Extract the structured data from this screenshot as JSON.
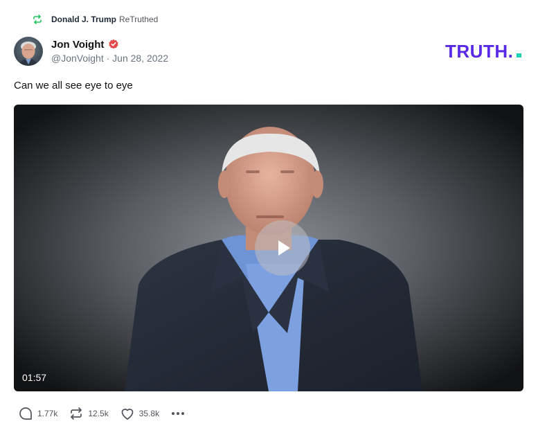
{
  "retruth": {
    "icon": "retruth-icon",
    "user": "Donald J. Trump",
    "label": "ReTruthed",
    "accent": "#22c55e"
  },
  "author": {
    "display_name": "Jon Voight",
    "handle": "@JonVoight",
    "separator": "·",
    "date": "Jun 28, 2022",
    "verified_color": "#e5484d",
    "avatar": "avatar-photo"
  },
  "brand": {
    "logo_text": "TRUTH.",
    "primary": "#5a29e8",
    "accent": "#1dd3b0"
  },
  "post": {
    "text": "Can we all see eye to eye"
  },
  "video": {
    "duration": "01:57",
    "play_icon": "play-icon"
  },
  "actions": {
    "replies": "1.77k",
    "retruths": "12.5k",
    "likes": "35.8k",
    "reply_icon": "reply-icon",
    "retruth_icon": "retruth-icon",
    "like_icon": "heart-icon",
    "more_icon": "more-icon"
  }
}
